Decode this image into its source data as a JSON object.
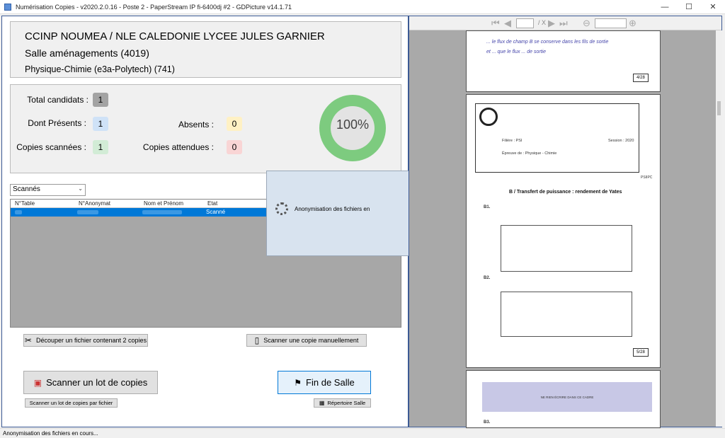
{
  "window": {
    "title": "Numérisation Copies - v2020.2.0.16 - Poste 2 - PaperStream IP fi-6400dj #2 - GDPicture v14.1.71"
  },
  "info": {
    "line1": "CCINP NOUMEA / NLE CALEDONIE LYCEE JULES GARNIER",
    "line2": "Salle aménagements (4019)",
    "line3": "Physique-Chimie (e3a-Polytech) (741)"
  },
  "stats": {
    "total_label": "Total candidats :",
    "total_value": "1",
    "presents_label": "Dont Présents :",
    "presents_value": "1",
    "absents_label": "Absents :",
    "absents_value": "0",
    "scanned_label": "Copies scannées :",
    "scanned_value": "1",
    "expected_label": "Copies attendues :",
    "expected_value": "0",
    "progress_text": "100%",
    "progress_fraction": 1.0
  },
  "filter": {
    "selected": "Scannés"
  },
  "grid": {
    "columns": [
      "N°Table",
      "N°Anonymat",
      "Nom et Prénom",
      "Etat"
    ],
    "rows": [
      {
        "etat": "Scanné"
      }
    ]
  },
  "buttons": {
    "split": "Découper un fichier contenant 2 copies",
    "manual": "Scanner une copie manuellement",
    "batch": "Scanner un lot de copies",
    "finish": "Fin de Salle",
    "batch_file": "Scanner un lot de copies par fichier",
    "folder": "Répertoire Salle"
  },
  "dialog": {
    "message": "Anonymisation des fichiers en"
  },
  "viewer": {
    "page_sep": "/ X",
    "p1_hw1": "... le flux de champ B se conserve dans les fils de sortie",
    "p1_hw2": "et ... que le flux ... de sortie",
    "page_num_1": "4/28",
    "p2_filiere": "Filière : PSI",
    "p2_session": "Session : 2020",
    "p2_epreuve": "Épreuve de : Physique - Chimie",
    "p2_code": "PSIIPC",
    "p2_heading": "B / Transfert de puissance : rendement de Yates",
    "p2_b1": "B1.",
    "p2_b2": "B2.",
    "page_num_2": "5/28",
    "p3_banner": "NE RIEN ÉCRIRE DANS CE CADRE",
    "p3_b3": "B3."
  },
  "status": {
    "text": "Anonymisation des fichiers en cours..."
  },
  "colors": {
    "accent": "#0078d7",
    "progress": "#7dcb7f",
    "frame": "#3c5a94"
  }
}
